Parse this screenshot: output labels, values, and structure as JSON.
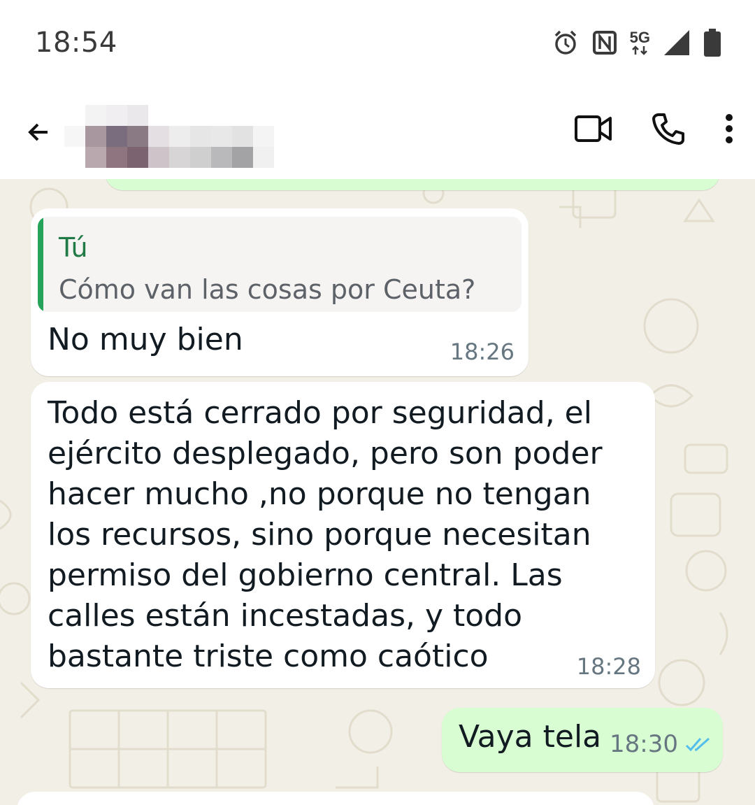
{
  "status_bar": {
    "time": "18:54",
    "network": "5G",
    "icons": [
      "alarm-icon",
      "nfc-icon",
      "5g-icon",
      "signal-icon",
      "battery-icon"
    ]
  },
  "app_bar": {
    "contact_name_redacted": true,
    "actions": [
      "video-call-icon",
      "voice-call-icon",
      "more-options-icon"
    ]
  },
  "colors": {
    "incoming_bubble": "#ffffff",
    "outgoing_bubble": "#d9fdd3",
    "chat_background": "#f2efe6",
    "quote_bar": "#25a35a",
    "read_ticks": "#53bdeb"
  },
  "messages": [
    {
      "direction": "incoming",
      "quote": {
        "author": "Tú",
        "text": "Cómo van las cosas por Ceuta?"
      },
      "text": "No muy bien",
      "time": "18:26"
    },
    {
      "direction": "incoming",
      "text": "Todo está cerrado por seguridad, el ejército desplegado, pero son poder hacer mucho ,no porque no tengan los recursos, sino porque necesitan permiso del gobierno central. Las calles están incestadas, y todo bastante triste como caótico",
      "time": "18:28"
    },
    {
      "direction": "outgoing",
      "text": "Vaya tela",
      "time": "18:30",
      "status": "read"
    }
  ]
}
